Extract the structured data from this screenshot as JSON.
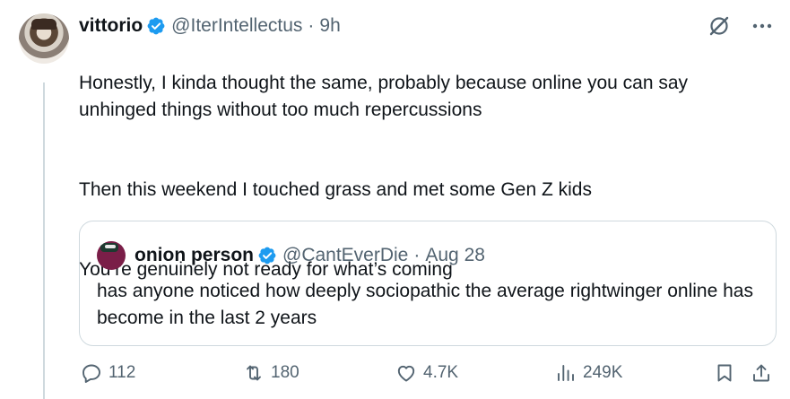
{
  "author": {
    "display_name": "vittorio",
    "handle": "@IterIntellectus",
    "dot": "·",
    "time": "9h",
    "verified_icon": "verified-badge-icon"
  },
  "tweet": {
    "paragraphs": [
      "Honestly, I kinda thought the same, probably because online you can say unhinged things without too much repercussions",
      "Then this weekend I touched grass and met some Gen Z kids",
      "You’re genuinely not ready for what’s coming"
    ]
  },
  "quoted": {
    "display_name": "onion person",
    "handle": "@CantEverDie",
    "dot": "·",
    "time": "Aug 28",
    "text": "has anyone noticed how deeply sociopathic the average rightwinger online has become in the last 2 years"
  },
  "actions": {
    "replies": "112",
    "reposts": "180",
    "likes": "4.7K",
    "views": "249K"
  },
  "colors": {
    "verified": "#1d9bf0",
    "secondary_text": "#536471",
    "border": "#cfd9de"
  }
}
